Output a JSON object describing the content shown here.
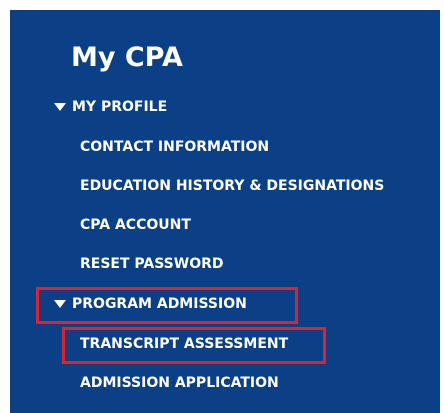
{
  "sidebar": {
    "title": "My CPA",
    "sections": [
      {
        "label": "MY PROFILE",
        "items": [
          {
            "label": "CONTACT INFORMATION"
          },
          {
            "label": "EDUCATION HISTORY & DESIGNATIONS"
          },
          {
            "label": "CPA ACCOUNT"
          },
          {
            "label": "RESET PASSWORD"
          }
        ]
      },
      {
        "label": "PROGRAM ADMISSION",
        "highlighted": true,
        "items": [
          {
            "label": "TRANSCRIPT ASSESSMENT",
            "highlighted": true
          },
          {
            "label": "ADMISSION APPLICATION"
          }
        ]
      }
    ]
  },
  "colors": {
    "panel_background": "#0b3f86",
    "text": "#ffffff",
    "highlight_border": "#e2212f"
  },
  "icons": {
    "expanded": "triangle-down-icon"
  }
}
